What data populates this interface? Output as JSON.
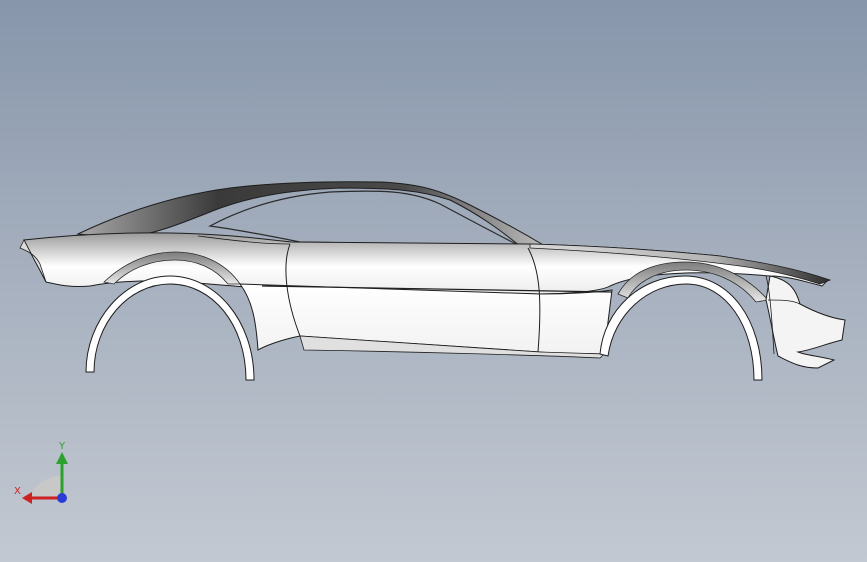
{
  "viewport": {
    "background_top": "#8796ab",
    "background_bottom": "#c3c9d2"
  },
  "model": {
    "view": "side",
    "object": "car-body-shell"
  },
  "triad": {
    "y_label": "Y",
    "x_label": "X",
    "y_color": "#2da12d",
    "x_color": "#cc2222",
    "z_color": "#2b3bd6"
  }
}
